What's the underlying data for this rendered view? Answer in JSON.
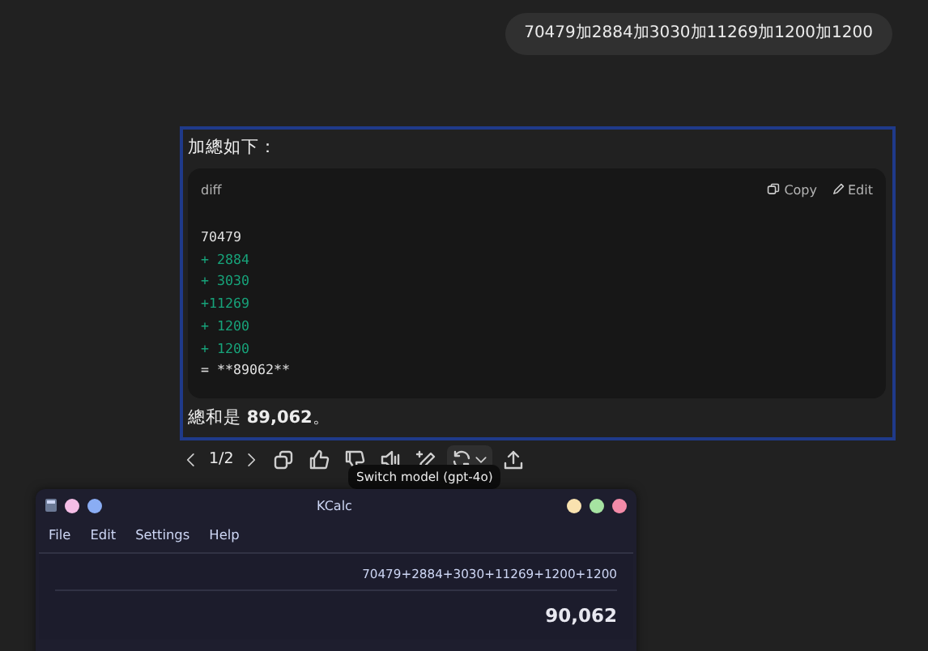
{
  "user_message": "70479加2884加3030加11269加1200加1200",
  "answer": {
    "intro": "加總如下：",
    "code_block": {
      "language": "diff",
      "actions": [
        "Copy",
        "Edit"
      ],
      "lines": [
        {
          "kind": "plain",
          "text": "70479"
        },
        {
          "kind": "added",
          "text": "+ 2884"
        },
        {
          "kind": "added",
          "text": "+ 3030"
        },
        {
          "kind": "added",
          "text": "+11269"
        },
        {
          "kind": "added",
          "text": "+ 1200"
        },
        {
          "kind": "added",
          "text": "+ 1200"
        },
        {
          "kind": "plain",
          "text": "= **89062**"
        }
      ]
    },
    "conclusion": "總和是 **89,062**。"
  },
  "toolbar": {
    "page": "1/2",
    "tooltip": "Switch model (gpt-4o)"
  },
  "kcalc": {
    "title": "KCalc",
    "menu": [
      "File",
      "Edit",
      "Settings",
      "Help"
    ],
    "expression": "70479+2884+3030+11269+1200+1200",
    "result": "90,062"
  }
}
